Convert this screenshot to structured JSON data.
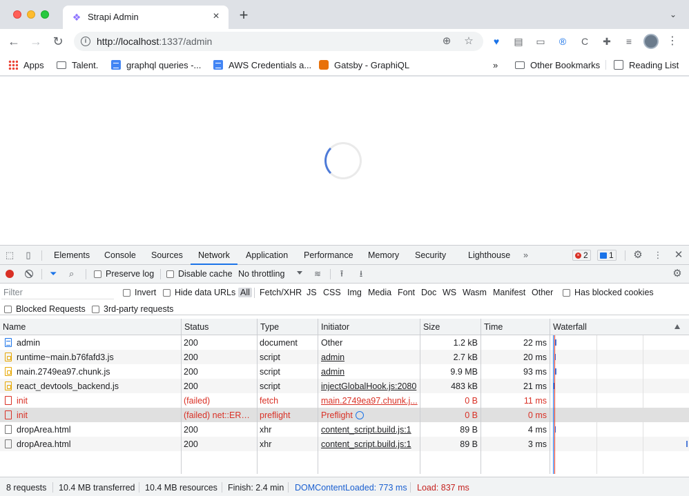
{
  "browser": {
    "tab_title": "Strapi Admin",
    "url_host": "http://localhost",
    "url_rest": ":1337/admin"
  },
  "bookmarks": [
    {
      "label": "Apps",
      "icon": "apps-icon"
    },
    {
      "label": "Talent.",
      "icon": "folder-icon"
    },
    {
      "label": "graphql queries -...",
      "icon": "doc-icon"
    },
    {
      "label": "AWS Credentials a...",
      "icon": "doc-icon"
    },
    {
      "label": "Gatsby - GraphiQL",
      "icon": "gatsby-icon"
    }
  ],
  "bookmarks_right": {
    "more": "»",
    "other": "Other Bookmarks",
    "reading": "Reading List"
  },
  "devtools": {
    "tabs": [
      "Elements",
      "Console",
      "Sources",
      "Network",
      "Application",
      "Performance",
      "Memory",
      "Security",
      "Lighthouse"
    ],
    "active_tab": "Network",
    "more_tabs": "»",
    "error_count": "2",
    "message_count": "1",
    "toolbar": {
      "preserve_log": "Preserve log",
      "disable_cache": "Disable cache",
      "throttling": "No throttling"
    },
    "filter": {
      "placeholder": "Filter",
      "invert": "Invert",
      "hide_data_urls": "Hide data URLs",
      "types": [
        "All",
        "Fetch/XHR",
        "JS",
        "CSS",
        "Img",
        "Media",
        "Font",
        "Doc",
        "WS",
        "Wasm",
        "Manifest",
        "Other"
      ],
      "has_blocked_cookies": "Has blocked cookies",
      "blocked_requests": "Blocked Requests",
      "third_party": "3rd-party requests"
    },
    "columns": [
      "Name",
      "Status",
      "Type",
      "Initiator",
      "Size",
      "Time",
      "Waterfall"
    ],
    "rows": [
      {
        "name": "admin",
        "status": "200",
        "type": "document",
        "initiator": "Other",
        "size": "1.2 kB",
        "time": "22 ms",
        "icon": "doc",
        "error": false,
        "link": false
      },
      {
        "name": "runtime~main.b76fafd3.js",
        "status": "200",
        "type": "script",
        "initiator": "admin",
        "size": "2.7 kB",
        "time": "20 ms",
        "icon": "js",
        "error": false,
        "link": true
      },
      {
        "name": "main.2749ea97.chunk.js",
        "status": "200",
        "type": "script",
        "initiator": "admin",
        "size": "9.9 MB",
        "time": "93 ms",
        "icon": "js",
        "error": false,
        "link": true
      },
      {
        "name": "react_devtools_backend.js",
        "status": "200",
        "type": "script",
        "initiator": "injectGlobalHook.js:2080",
        "size": "483 kB",
        "time": "21 ms",
        "icon": "js",
        "error": false,
        "link": true
      },
      {
        "name": "init",
        "status": "(failed)",
        "type": "fetch",
        "initiator": "main.2749ea97.chunk.j...",
        "size": "0 B",
        "time": "11 ms",
        "icon": "err",
        "error": true,
        "link": true
      },
      {
        "name": "init",
        "status": "(failed) net::ERR...",
        "type": "preflight",
        "initiator": "Preflight",
        "size": "0 B",
        "time": "0 ms",
        "icon": "err",
        "error": true,
        "link": false
      },
      {
        "name": "dropArea.html",
        "status": "200",
        "type": "xhr",
        "initiator": "content_script.build.js:1",
        "size": "89 B",
        "time": "4 ms",
        "icon": "plain",
        "error": false,
        "link": true
      },
      {
        "name": "dropArea.html",
        "status": "200",
        "type": "xhr",
        "initiator": "content_script.build.js:1",
        "size": "89 B",
        "time": "3 ms",
        "icon": "plain",
        "error": false,
        "link": true
      }
    ],
    "status_bar": {
      "requests": "8 requests",
      "transferred": "10.4 MB transferred",
      "resources": "10.4 MB resources",
      "finish": "Finish: 2.4 min",
      "dom_loaded": "DOMContentLoaded: 773 ms",
      "load": "Load: 837 ms"
    }
  },
  "colors": {
    "accent": "#1a73e8",
    "error": "#d93025",
    "dom_loaded": "#1a5fd0",
    "load": "#c5221f"
  }
}
